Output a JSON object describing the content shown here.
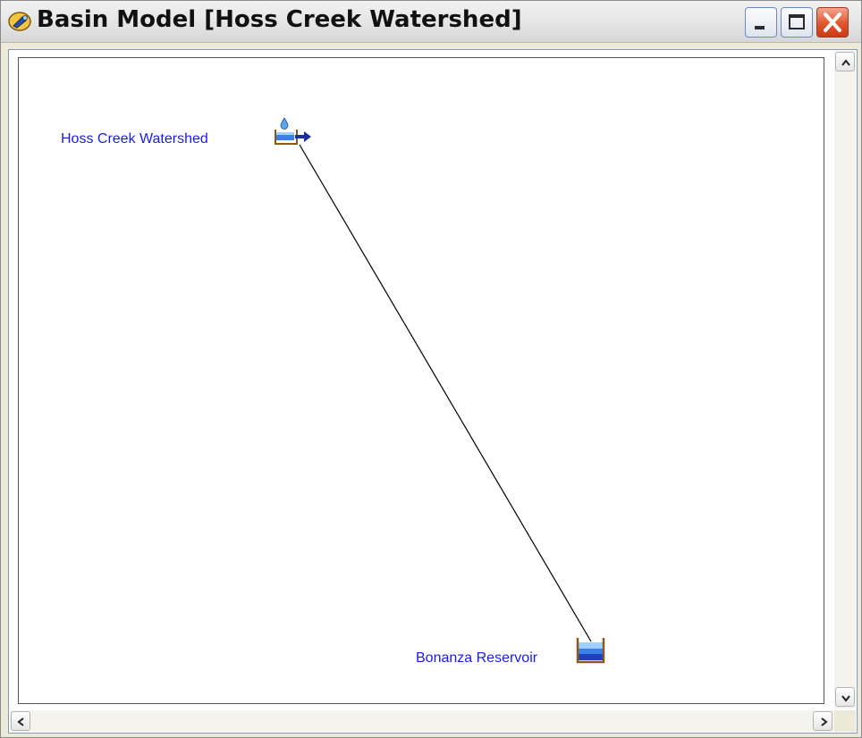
{
  "window": {
    "title": "Basin Model [Hoss Creek Watershed]",
    "title_icon": "basin-model-icon",
    "buttons": {
      "minimize": "minimize-icon",
      "maximize": "maximize-icon",
      "close": "close-icon"
    }
  },
  "canvas": {
    "elements": [
      {
        "type": "subbasin",
        "label": "Hoss Creek Watershed",
        "icon": "subbasin-icon"
      },
      {
        "type": "reservoir",
        "label": "Bonanza Reservoir",
        "icon": "reservoir-icon"
      }
    ],
    "connection": {
      "from": "Hoss Creek Watershed",
      "to": "Bonanza Reservoir"
    }
  },
  "scrollbars": {
    "vertical": {
      "up": "arrow-up-icon",
      "down": "arrow-down-icon"
    },
    "horizontal": {
      "left": "arrow-left-icon",
      "right": "arrow-right-icon"
    }
  },
  "colors": {
    "label": "#1a1aee",
    "water": "#3b7fe8",
    "basin_outline": "#8b5a1b",
    "link": "#000000"
  }
}
